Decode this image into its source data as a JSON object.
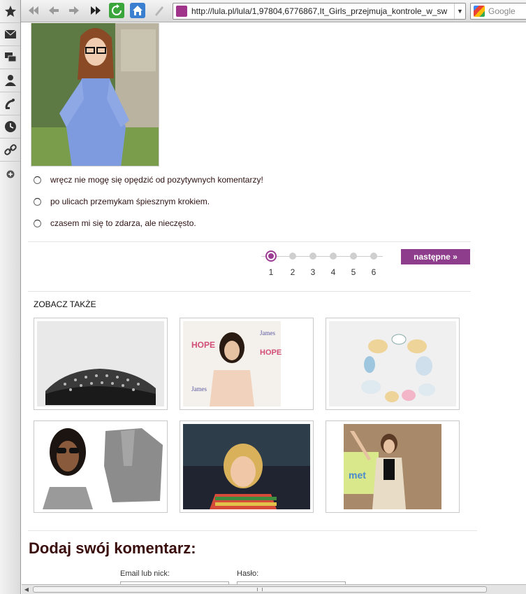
{
  "browser": {
    "address_url": "http://lula.pl/lula/1,97804,6776867,It_Girls_przejmuja_kontrole_w_sw",
    "search_placeholder": "Google"
  },
  "sidebar": {
    "icons": [
      "star-icon",
      "mail-icon",
      "chat-icon",
      "contacts-icon",
      "feeds-icon",
      "history-icon",
      "links-icon",
      "add-panel-icon"
    ]
  },
  "quiz": {
    "options": [
      "wręcz nie mogę się opędzić od pozytywnych komentarzy!",
      "po ulicach przemykam śpiesznym krokiem.",
      "czasem mi się to zdarza, ale nieczęsto."
    ]
  },
  "pager": {
    "pages": [
      "1",
      "2",
      "3",
      "4",
      "5",
      "6"
    ],
    "current_page": "1",
    "next_label": "następne »"
  },
  "see_also": {
    "heading": "ZOBACZ TAKŻE",
    "thumbnails": [
      "studded-loafers-photo",
      "celebrity-event-photo",
      "shell-jewelry-photo",
      "sunglasses-girl-photo",
      "blonde-woman-photo",
      "tv-show-photo"
    ]
  },
  "comment_form": {
    "title": "Dodaj swój komentarz:",
    "email_label": "Email lub nick:",
    "password_label": "Hasło:"
  }
}
